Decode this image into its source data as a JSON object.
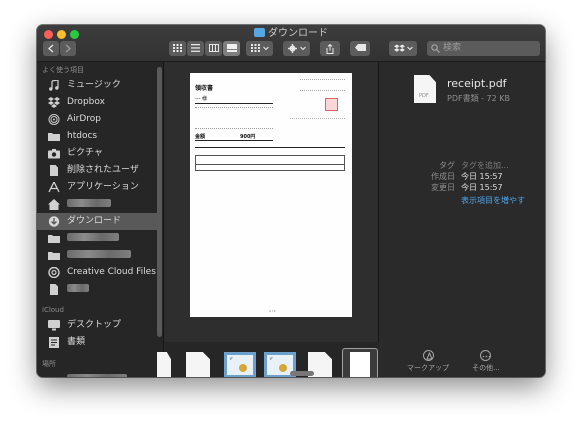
{
  "window": {
    "title": "ダウンロード"
  },
  "toolbar": {
    "search_placeholder": "検索",
    "back_icon": "chevron-left-icon",
    "forward_icon": "chevron-right-icon"
  },
  "sidebar": {
    "favorites_header": "よく使う項目",
    "icloud_header": "iCloud",
    "locations_header": "場所",
    "items": [
      {
        "label": "ミュージック",
        "icon": "music-icon"
      },
      {
        "label": "Dropbox",
        "icon": "dropbox-icon"
      },
      {
        "label": "AirDrop",
        "icon": "airdrop-icon"
      },
      {
        "label": "htdocs",
        "icon": "folder-icon"
      },
      {
        "label": "ピクチャ",
        "icon": "camera-icon"
      },
      {
        "label": "削除されたユーザ",
        "icon": "document-icon"
      },
      {
        "label": "アプリケーション",
        "icon": "applications-icon"
      },
      {
        "label": "",
        "icon": "home-icon"
      },
      {
        "label": "ダウンロード",
        "icon": "download-icon"
      },
      {
        "label": "",
        "icon": "folder-icon"
      },
      {
        "label": "",
        "icon": "folder-icon"
      },
      {
        "label": "Creative Cloud Files",
        "icon": "creative-cloud-icon"
      },
      {
        "label": "",
        "icon": "document-icon"
      }
    ],
    "icloud_items": [
      {
        "label": "デスクトップ",
        "icon": "desktop-icon"
      },
      {
        "label": "書類",
        "icon": "documents-icon"
      }
    ]
  },
  "preview": {
    "doc_title": "領収書",
    "doc_to": "--- 様",
    "amount_label": "金額",
    "amount_value": "900円",
    "page_number": "1 / 1"
  },
  "info": {
    "file_name": "receipt.pdf",
    "file_kind": "PDF書類 - 72 KB",
    "pdf_badge": "PDF",
    "tags_label": "タグ",
    "tags_placeholder": "タグを追加...",
    "created_label": "作成日",
    "created_value": "今日 15:57",
    "modified_label": "変更日",
    "modified_value": "今日 15:57",
    "show_more": "表示項目を増やす",
    "markup_label": "マークアップ",
    "more_label": "その他..."
  },
  "colors": {
    "accent": "#4fa6ea",
    "selection": "#595959",
    "close": "#fc5f57",
    "minimize": "#fdbb2e",
    "maximize": "#29c940"
  }
}
